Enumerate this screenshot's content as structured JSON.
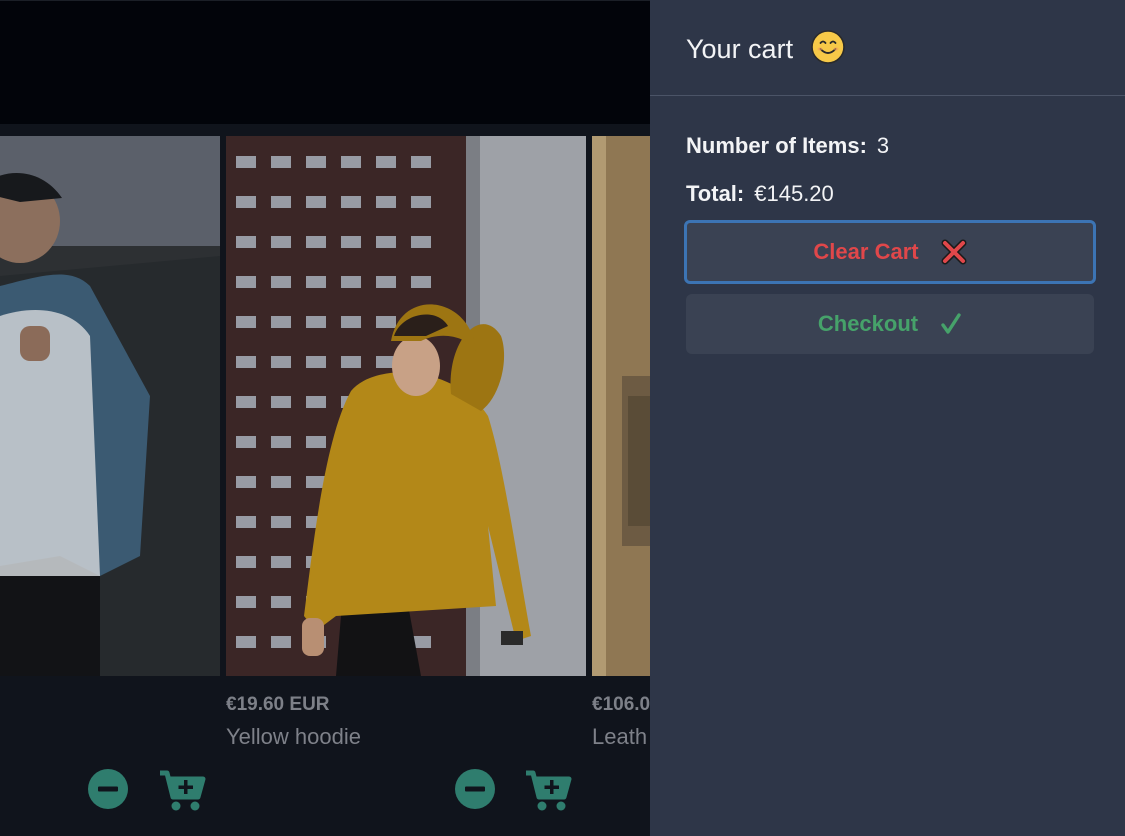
{
  "cart": {
    "title": "Your cart",
    "items_label": "Number of Items:",
    "items_value": "3",
    "total_label": "Total:",
    "total_value": "€145.20",
    "clear_label": "Clear Cart",
    "checkout_label": "Checkout"
  },
  "products": [
    {
      "price": "",
      "name": ""
    },
    {
      "price": "€19.60 EUR",
      "name": "Yellow hoodie"
    },
    {
      "price": "€106.0",
      "name": "Leath"
    }
  ],
  "colors": {
    "panel_bg": "#2e3648",
    "button_bg": "#3a4253",
    "clear_text": "#e0474a",
    "checkout_text": "#46a26a",
    "focus_ring": "#3c74b4",
    "action_icon": "#2f7d6e"
  },
  "icons": [
    "smile-emoji-icon",
    "cross-mark-icon",
    "check-mark-icon",
    "minus-circle-icon",
    "cart-plus-icon"
  ]
}
